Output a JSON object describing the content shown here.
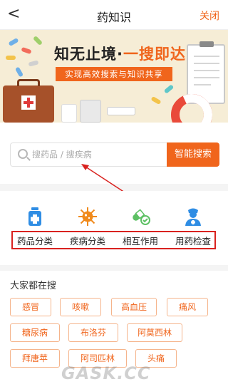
{
  "header": {
    "back_glyph": "<",
    "title": "药知识",
    "close_label": "关闭"
  },
  "banner": {
    "title_part1": "知无止境·",
    "title_part2": "一搜即达",
    "subtitle": "实现高效搜索与知识共享"
  },
  "search": {
    "placeholder": "搜药品 / 搜疾病",
    "button_label": "智能搜索"
  },
  "categories": [
    {
      "label": "药品分类",
      "icon": "medicine-bottle-icon"
    },
    {
      "label": "疾病分类",
      "icon": "virus-icon"
    },
    {
      "label": "相互作用",
      "icon": "pill-interaction-icon"
    },
    {
      "label": "用药检查",
      "icon": "doctor-icon"
    }
  ],
  "popular": {
    "title": "大家都在搜",
    "tags": [
      "感冒",
      "咳嗽",
      "高血压",
      "痛风",
      "糖尿病",
      "布洛芬",
      "阿莫西林",
      "拜唐苹",
      "阿司匹林",
      "头痛"
    ]
  },
  "watermark": "GASK.CC",
  "colors": {
    "accent": "#f0651c",
    "annotation_red": "#d9221f",
    "tag_border": "#f5b48b",
    "banner_bg": "#f6edd6"
  }
}
